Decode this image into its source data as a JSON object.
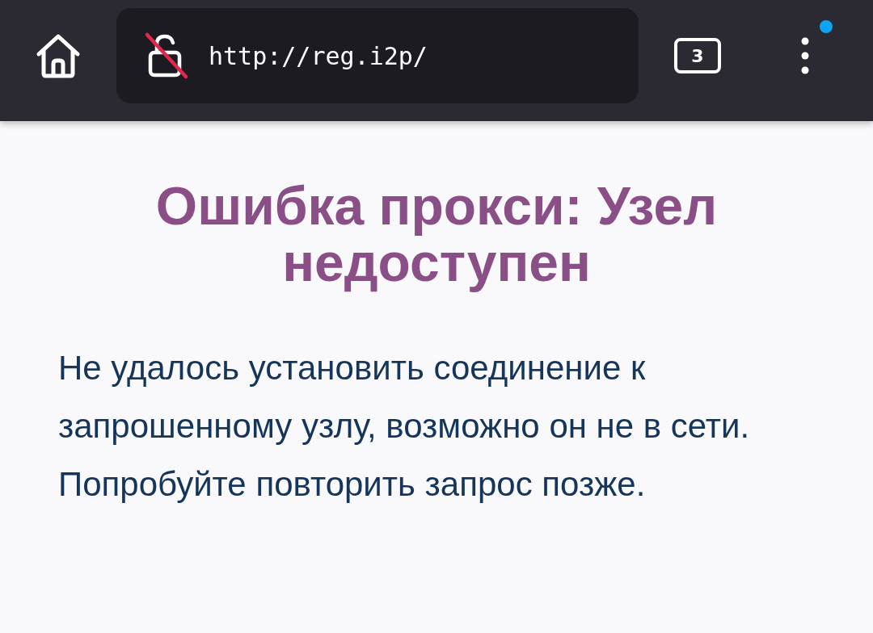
{
  "toolbar": {
    "url": "http://reg.i2p/",
    "connection_insecure": true,
    "tab_count": "3",
    "menu_notification": true
  },
  "page": {
    "heading": "Ошибка прокси: Узел недоступен",
    "message": "Не удалось установить соединение к запрошенному узлу, возможно он не в сети. Попробуйте повторить запрос позже."
  }
}
